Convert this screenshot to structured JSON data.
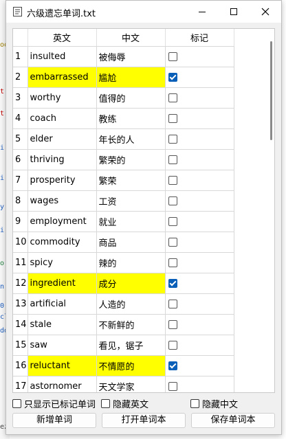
{
  "window": {
    "title": "六级遗忘单词.txt"
  },
  "table": {
    "headers": {
      "index": "",
      "english": "英文",
      "chinese": "中文",
      "mark": "标记"
    },
    "rows": [
      {
        "n": "1",
        "en": "insulted",
        "zh": "被侮辱",
        "marked": false
      },
      {
        "n": "2",
        "en": "embarrassed",
        "zh": "尴尬",
        "marked": true
      },
      {
        "n": "3",
        "en": "worthy",
        "zh": "值得的",
        "marked": false
      },
      {
        "n": "4",
        "en": "coach",
        "zh": "教练",
        "marked": false
      },
      {
        "n": "5",
        "en": "elder",
        "zh": "年长的人",
        "marked": false
      },
      {
        "n": "6",
        "en": "thriving",
        "zh": "繁荣的",
        "marked": false
      },
      {
        "n": "7",
        "en": "prosperity",
        "zh": "繁荣",
        "marked": false
      },
      {
        "n": "8",
        "en": "wages",
        "zh": "工资",
        "marked": false
      },
      {
        "n": "9",
        "en": "employment",
        "zh": "就业",
        "marked": false
      },
      {
        "n": "10",
        "en": "commodity",
        "zh": "商品",
        "marked": false
      },
      {
        "n": "11",
        "en": "spicy",
        "zh": "辣的",
        "marked": false
      },
      {
        "n": "12",
        "en": "ingredient",
        "zh": "成分",
        "marked": true
      },
      {
        "n": "13",
        "en": "artificial",
        "zh": "人造的",
        "marked": false
      },
      {
        "n": "14",
        "en": "stale",
        "zh": "不新鲜的",
        "marked": false
      },
      {
        "n": "15",
        "en": "saw",
        "zh": "看见，锯子",
        "marked": false
      },
      {
        "n": "16",
        "en": "reluctant",
        "zh": "不情愿的",
        "marked": true
      },
      {
        "n": "17",
        "en": "astornomer",
        "zh": "天文学家",
        "marked": false
      }
    ]
  },
  "options": {
    "show_marked_only": "只显示已标记单词",
    "hide_english": "隐藏英文",
    "hide_chinese": "隐藏中文"
  },
  "buttons": {
    "add_word": "新增单词",
    "open_wordbook": "打开单词本",
    "save_wordbook": "保存单词本"
  },
  "colors": {
    "highlight": "#ffff00",
    "checkbox_checked": "#0a5fb8",
    "window_bg": "#f0f0f0"
  },
  "background_strip": [
    "oo",
    "t",
    "t",
    "i",
    "i",
    "y",
    "i",
    "o",
    "n",
    "0",
    "cl",
    "dd",
    "ez"
  ]
}
